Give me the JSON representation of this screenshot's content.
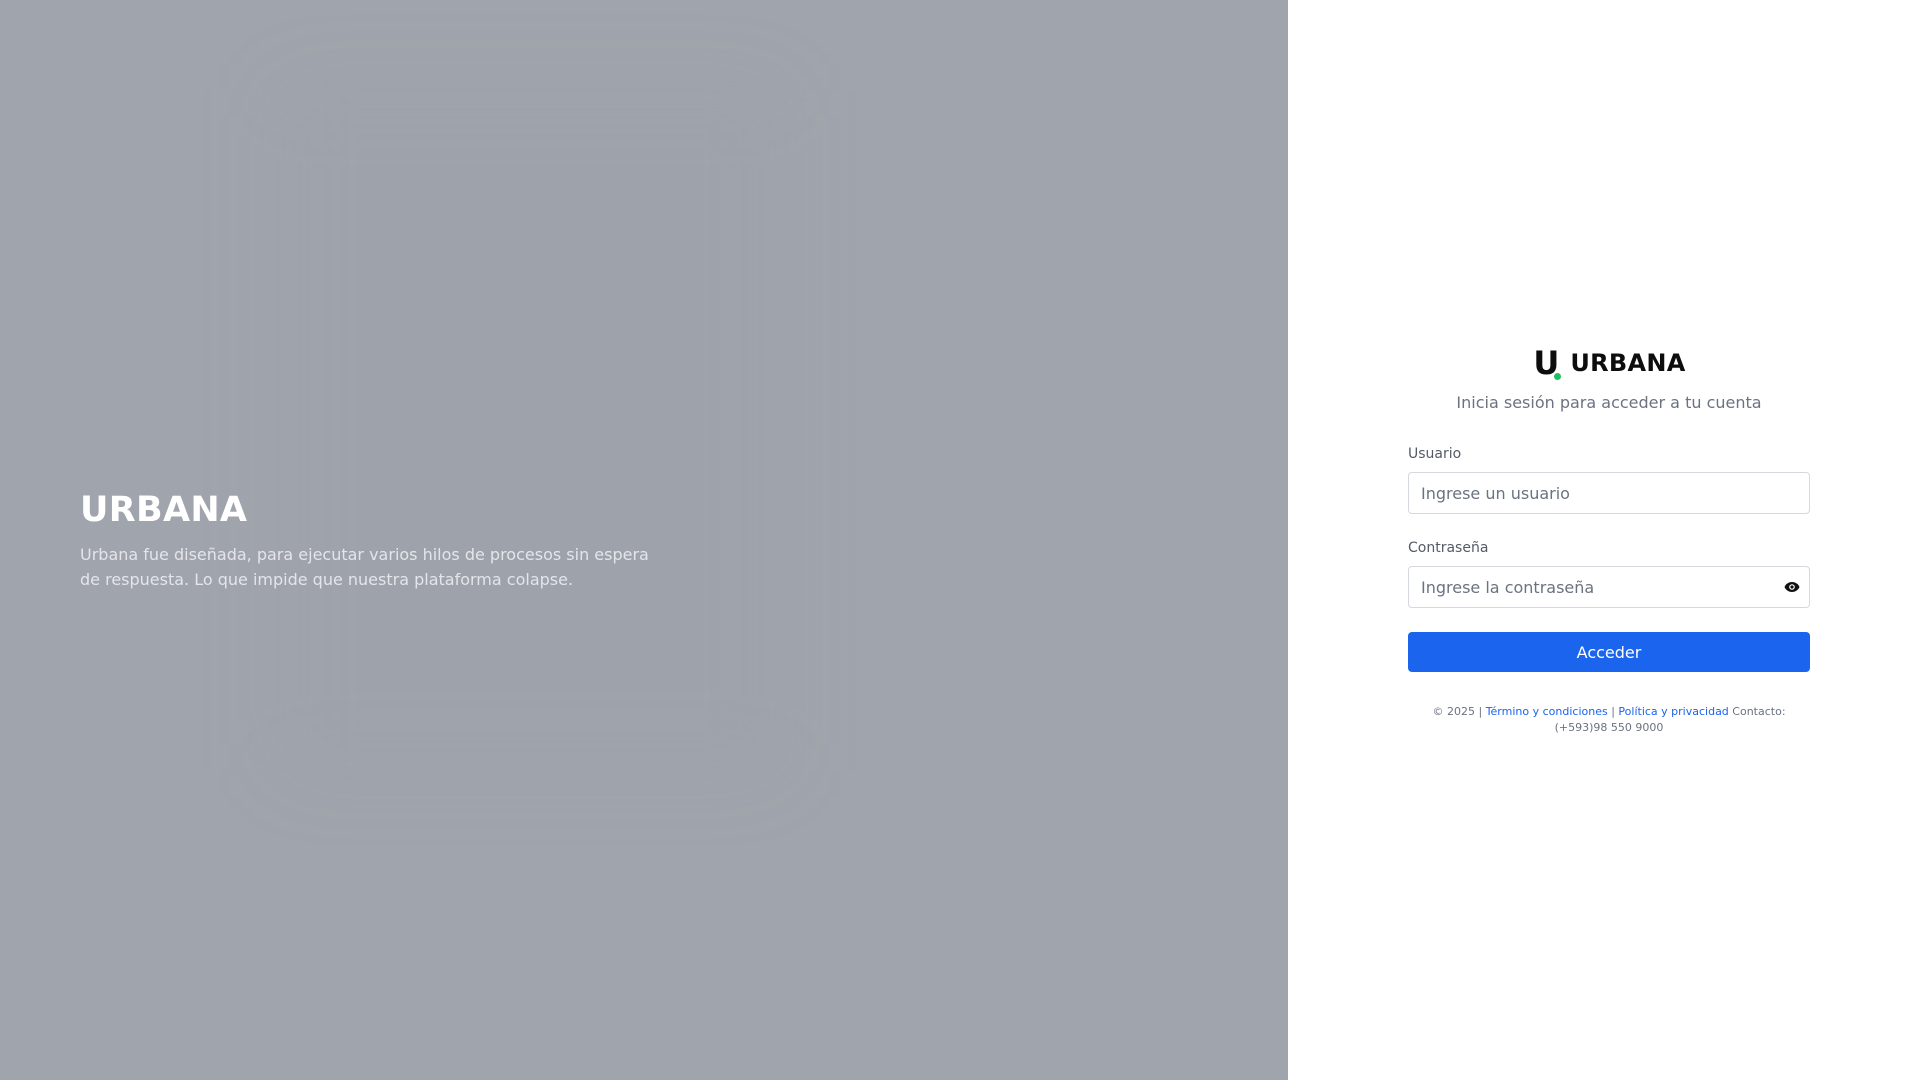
{
  "hero": {
    "title": "URBANA",
    "description": "Urbana fue diseñada, para ejecutar varios hilos de procesos sin espera de respuesta. Lo que impide que nuestra plataforma colapse."
  },
  "login": {
    "brand": {
      "logo_letter": "U",
      "name": "URBANA"
    },
    "subtitle": "Inicia sesión para acceder a tu cuenta",
    "username": {
      "label": "Usuario",
      "placeholder": "Ingrese un usuario",
      "value": ""
    },
    "password": {
      "label": "Contraseña",
      "placeholder": "Ingrese la contraseña",
      "value": "",
      "toggle_icon": "eye-icon"
    },
    "submit_label": "Acceder"
  },
  "footer": {
    "copyright": "© 2025",
    "separator": "|",
    "terms_link": "Término y condiciones",
    "privacy_link": "Política y privacidad",
    "contact_label": "Contacto:",
    "contact_phone": "(+593)98 550 9000"
  },
  "colors": {
    "hero_background": "#a0a4ac",
    "primary": "#1a64ee",
    "logo_dot": "#1fbf64"
  }
}
